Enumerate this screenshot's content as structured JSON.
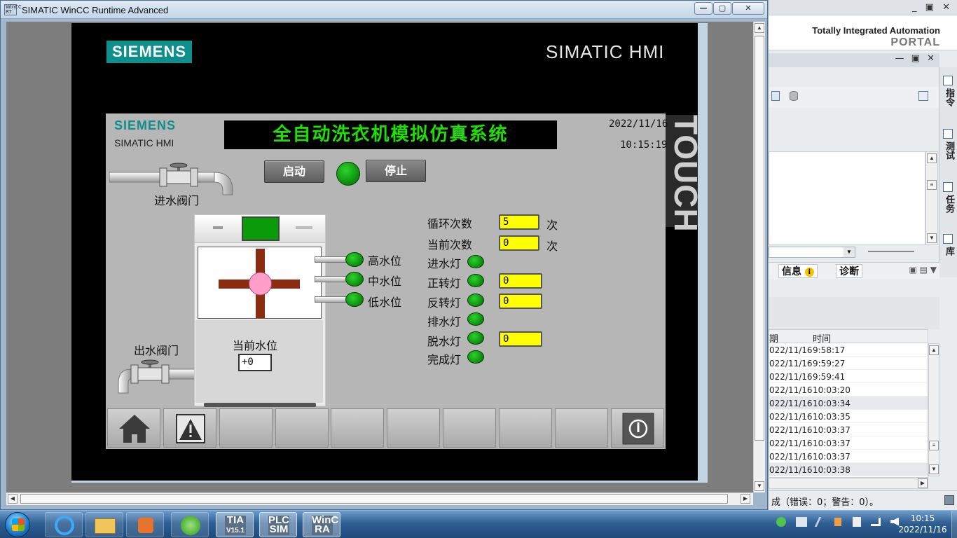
{
  "wincc": {
    "window_title": "SIMATIC WinCC Runtime Advanced",
    "icon_text": "WinCC RT",
    "minimize": "—",
    "maximize": "▢",
    "close": "✕"
  },
  "panel": {
    "brand": "SIEMENS",
    "model": "SIMATIC HMI",
    "touch": "TOUCH"
  },
  "screen": {
    "brand": "SIEMENS",
    "model": "SIMATIC HMI",
    "title": "全自动洗衣机模拟仿真系统",
    "date": "2022/11/16",
    "time": "10:15:19",
    "start_label": "启动",
    "stop_label": "停止",
    "inlet_valve_label": "进水阀门",
    "outlet_valve_label": "出水阀门",
    "sensors": [
      {
        "label": "高水位"
      },
      {
        "label": "中水位"
      },
      {
        "label": "低水位"
      }
    ],
    "current_level_label": "当前水位",
    "current_level_value": "+0",
    "cycles_label": "循环次数",
    "cycles_value": "5",
    "cycles_unit": "次",
    "current_count_label": "当前次数",
    "current_count_value": "0",
    "current_count_unit": "次",
    "lights": [
      {
        "label": "进水灯",
        "value": null
      },
      {
        "label": "正转灯",
        "value": "0"
      },
      {
        "label": "反转灯",
        "value": "0"
      },
      {
        "label": "排水灯",
        "value": null
      },
      {
        "label": "脱水灯",
        "value": "0"
      },
      {
        "label": "完成灯",
        "value": null
      }
    ],
    "colors": {
      "title_text": "#1ee000",
      "lamp_on": "#0b8a0b",
      "field_bg": "#ffff00",
      "agitator": "#8b2b10",
      "hub": "#ff9ec9",
      "siemens_teal": "#0e8f8c"
    }
  },
  "tia": {
    "brand_line1": "Totally Integrated Automation",
    "brand_line2": "PORTAL",
    "side_tabs": [
      "指令",
      "测试",
      "任务",
      "库"
    ],
    "info_tab": "信息",
    "info_badge": "i",
    "diag_tab": "诊断",
    "log_headers": [
      "期",
      "时间"
    ],
    "log_rows": [
      {
        "date": "022/11/16",
        "time": "9:58:17"
      },
      {
        "date": "022/11/16",
        "time": "9:59:27"
      },
      {
        "date": "022/11/16",
        "time": "9:59:41"
      },
      {
        "date": "022/11/16",
        "time": "10:03:20"
      },
      {
        "date": "022/11/16",
        "time": "10:03:34"
      },
      {
        "date": "022/11/16",
        "time": "10:03:35"
      },
      {
        "date": "022/11/16",
        "time": "10:03:37"
      },
      {
        "date": "022/11/16",
        "time": "10:03:37"
      },
      {
        "date": "022/11/16",
        "time": "10:03:37"
      },
      {
        "date": "022/11/16",
        "time": "10:03:38"
      }
    ],
    "status": "成（错误：0；警告：0）。"
  },
  "taskbar": {
    "apps": [
      {
        "label": "IE"
      },
      {
        "label": "Explorer"
      },
      {
        "label": "Media"
      },
      {
        "label": "Update"
      },
      {
        "label": "TIA V15.1"
      },
      {
        "label": "PLC SIM"
      },
      {
        "label": "WinCC RA"
      }
    ],
    "tia_icon": "TIA",
    "tia_ver": "V15.1",
    "plc_icon": "PLC",
    "plc_sub": "SIM",
    "wincc_icon": "WinC",
    "wincc_sub": "RA",
    "clock_time": "10:15",
    "clock_date": "2022/11/16"
  }
}
